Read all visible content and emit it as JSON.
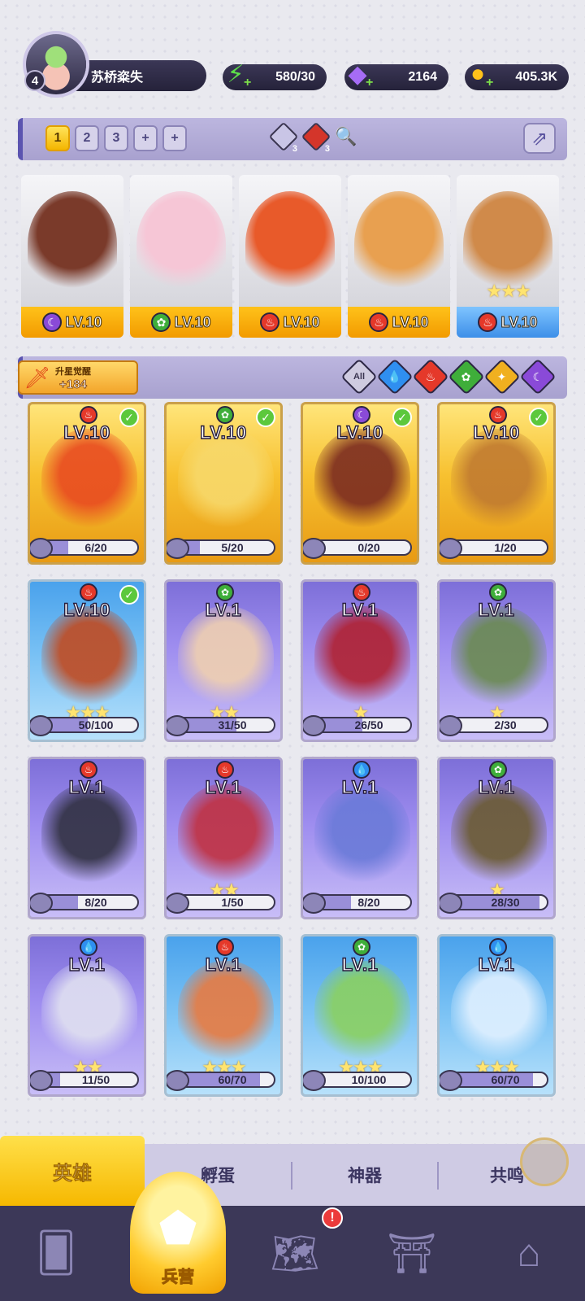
{
  "player": {
    "level": "4",
    "name": "苏桥粢失"
  },
  "resources": {
    "energy": "580/30",
    "gems": "2164",
    "gold": "405.3K"
  },
  "team": {
    "slots": [
      "1",
      "2",
      "3",
      "+",
      "+"
    ],
    "active_slot": "1",
    "counts": [
      "3",
      "3"
    ],
    "cards": [
      {
        "level": "LV.10",
        "element": "dark"
      },
      {
        "level": "LV.10",
        "element": "nature"
      },
      {
        "level": "LV.10",
        "element": "fire"
      },
      {
        "level": "LV.10",
        "element": "fire"
      },
      {
        "level": "LV.10",
        "element": "fire",
        "stars": "★★★"
      }
    ]
  },
  "awaken": {
    "title": "升星觉醒",
    "value": "+184"
  },
  "filters": [
    "All",
    "water",
    "fire",
    "nature",
    "light",
    "dark"
  ],
  "heroes": [
    {
      "level": "LV.10",
      "element": "fire",
      "rarity": "gold",
      "checked": true,
      "progress": "6/20",
      "ratio": 0.3
    },
    {
      "level": "LV.10",
      "element": "nature",
      "rarity": "gold",
      "checked": true,
      "progress": "5/20",
      "ratio": 0.25
    },
    {
      "level": "LV.10",
      "element": "dark",
      "rarity": "gold",
      "checked": true,
      "progress": "0/20",
      "ratio": 0
    },
    {
      "level": "LV.10",
      "element": "fire",
      "rarity": "gold",
      "checked": true,
      "progress": "1/20",
      "ratio": 0.05
    },
    {
      "level": "LV.10",
      "element": "fire",
      "rarity": "blue",
      "checked": true,
      "progress": "50/100",
      "ratio": 0.5,
      "stars": "★★★"
    },
    {
      "level": "LV.1",
      "element": "nature",
      "rarity": "purple",
      "checked": false,
      "progress": "31/50",
      "ratio": 0.62,
      "stars": "★★"
    },
    {
      "level": "LV.1",
      "element": "fire",
      "rarity": "purple",
      "checked": false,
      "progress": "26/50",
      "ratio": 0.52,
      "stars": "★"
    },
    {
      "level": "LV.1",
      "element": "nature",
      "rarity": "purple",
      "checked": false,
      "progress": "2/30",
      "ratio": 0.07,
      "stars": "★"
    },
    {
      "level": "LV.1",
      "element": "fire",
      "rarity": "purple",
      "checked": false,
      "progress": "8/20",
      "ratio": 0.4
    },
    {
      "level": "LV.1",
      "element": "fire",
      "rarity": "purple",
      "checked": false,
      "progress": "1/50",
      "ratio": 0.02,
      "stars": "★★"
    },
    {
      "level": "LV.1",
      "element": "water",
      "rarity": "purple",
      "checked": false,
      "progress": "8/20",
      "ratio": 0.4
    },
    {
      "level": "LV.1",
      "element": "nature",
      "rarity": "purple",
      "checked": false,
      "progress": "28/30",
      "ratio": 0.93,
      "stars": "★"
    },
    {
      "level": "LV.1",
      "element": "water",
      "rarity": "purple",
      "checked": false,
      "progress": "11/50",
      "ratio": 0.22,
      "stars": "★★"
    },
    {
      "level": "LV.1",
      "element": "fire",
      "rarity": "blue",
      "checked": false,
      "progress": "60/70",
      "ratio": 0.86,
      "stars": "★★★"
    },
    {
      "level": "LV.1",
      "element": "nature",
      "rarity": "blue",
      "checked": false,
      "progress": "10/100",
      "ratio": 0.1,
      "stars": "★★★"
    },
    {
      "level": "LV.1",
      "element": "water",
      "rarity": "blue",
      "checked": false,
      "progress": "60/70",
      "ratio": 0.86,
      "stars": "★★★"
    }
  ],
  "tabs": [
    "英雄",
    "孵蛋",
    "神器",
    "共鸣"
  ],
  "active_tab": "英雄",
  "nav": {
    "active_label": "兵营",
    "alert": "!",
    "icons": [
      "cards-icon",
      "map-icon",
      "barracks-icon",
      "shrine-icon",
      "mushroom-house-icon"
    ]
  },
  "colors": {
    "fire": "#e5392a",
    "nature": "#3fae3a",
    "water": "#2f8ff0",
    "dark": "#8a4ad8",
    "light": "#f0b020",
    "accent": "#ffcb2e"
  },
  "element_glyphs": {
    "fire": "♨",
    "nature": "✿",
    "water": "💧",
    "dark": "☾",
    "light": "✦"
  }
}
